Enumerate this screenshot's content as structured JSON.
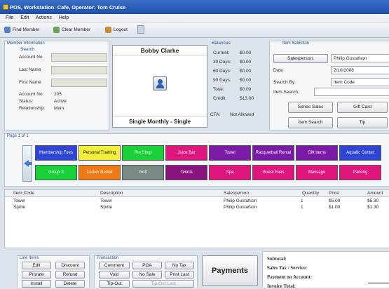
{
  "window": {
    "title": "POS, Workstation: Cafe, Operator: Tom Cruise"
  },
  "menu": [
    "File",
    "Edit",
    "Actions",
    "Help"
  ],
  "toolbar": {
    "find_member": "Find Member",
    "clear_member": "Clear Member",
    "logout": "Logout"
  },
  "member_info": {
    "title": "Member Information",
    "search_title": "Search",
    "account_no_label": "Account No",
    "last_name_label": "Last Name",
    "first_name_label": "First Name",
    "details": [
      {
        "label": "Account No:",
        "value": "205"
      },
      {
        "label": "Status:",
        "value": "Active"
      },
      {
        "label": "Relationship:",
        "value": "Main"
      }
    ]
  },
  "member_card": {
    "name": "Bobby Clarke",
    "membership": "Single Monthly - Single"
  },
  "balances": {
    "title": "Balances",
    "rows": [
      {
        "label": "Current:",
        "value": "$0.00"
      },
      {
        "label": "30 Days:",
        "value": "$0.00"
      },
      {
        "label": "60 Days:",
        "value": "$0.00"
      },
      {
        "label": "90 Days:",
        "value": "$0.00"
      },
      {
        "label": "Total:",
        "value": "$0.00"
      },
      {
        "label": "Credit:",
        "value": "$13.00"
      }
    ],
    "cta_label": "CTA:",
    "cta_value": "Not Allowed"
  },
  "item_selection": {
    "title": "Item Selection",
    "salesperson_button": "Salesperson:",
    "salesperson_value": "Philip Gustafson",
    "date_label": "Date",
    "date_value": "2/10/2008",
    "search_by_label": "Search By:",
    "search_by_value": "Item Code",
    "item_search_label": "Item Search:",
    "item_search_value": "",
    "buttons": {
      "series_sales": "Series Sales",
      "gift_card": "Gift Card",
      "item_search": "Item Search",
      "tip": "Tip"
    }
  },
  "page_label": "Page 1 of 1",
  "tiles": [
    {
      "label": "Membership Fees",
      "color": "#2f45d6",
      "dark": false
    },
    {
      "label": "Personal Training",
      "color": "#f2ee3a",
      "dark": true
    },
    {
      "label": "Pro Shop",
      "color": "#19d23a",
      "dark": false
    },
    {
      "label": "Juice Bar",
      "color": "#e0167f",
      "dark": false
    },
    {
      "label": "Towel",
      "color": "#7a1aa6",
      "dark": false
    },
    {
      "label": "Racquetball Rental",
      "color": "#7a1aa6",
      "dark": false
    },
    {
      "label": "Gift Items",
      "color": "#7a1aa6",
      "dark": false
    },
    {
      "label": "Aquatic Center",
      "color": "#2f45d6",
      "dark": false
    },
    {
      "label": "Group X",
      "color": "#19d23a",
      "dark": false
    },
    {
      "label": "Locker Rental",
      "color": "#f07a16",
      "dark": false
    },
    {
      "label": "Golf",
      "color": "#7a8a86",
      "dark": false
    },
    {
      "label": "Tennis",
      "color": "#8a147f",
      "dark": false
    },
    {
      "label": "Spa",
      "color": "#e0167f",
      "dark": false
    },
    {
      "label": "Guest Fees",
      "color": "#e0167f",
      "dark": false
    },
    {
      "label": "Massage",
      "color": "#e0167f",
      "dark": false
    },
    {
      "label": "Parking",
      "color": "#e0167f",
      "dark": false
    }
  ],
  "items_table": {
    "headers": [
      "Item Code",
      "Description",
      "Salesperson",
      "Quantity",
      "Price",
      "Amount"
    ],
    "rows": [
      [
        "Towel",
        "Towel",
        "Philip Gustafson",
        "1",
        "$5.00",
        "$5.30"
      ],
      [
        "Sprite",
        "Sprite",
        "Philip Gustafson",
        "1",
        "$1.00",
        "$1.30"
      ]
    ]
  },
  "line_items": {
    "title": "Line Items",
    "buttons": [
      "Edit",
      "Discount",
      "Prorate",
      "Refund",
      "Install",
      "Delete"
    ]
  },
  "transaction": {
    "title": "Transaction",
    "buttons": [
      "Comment",
      "POA",
      "No Tax",
      "Void",
      "No Sale",
      "Print Last",
      "Tip-Out",
      "Tip-Out Last"
    ]
  },
  "payments_button": "Payments",
  "totals": {
    "subtotal": "Subtotal:",
    "sales_tax": "Sales Tax / Service:",
    "payment_on_account": "Payment on Account:",
    "invoice_total": "Invoice Total:"
  },
  "colors": {
    "title_bar": "#1c4fa8",
    "accent_label": "#34548a"
  }
}
